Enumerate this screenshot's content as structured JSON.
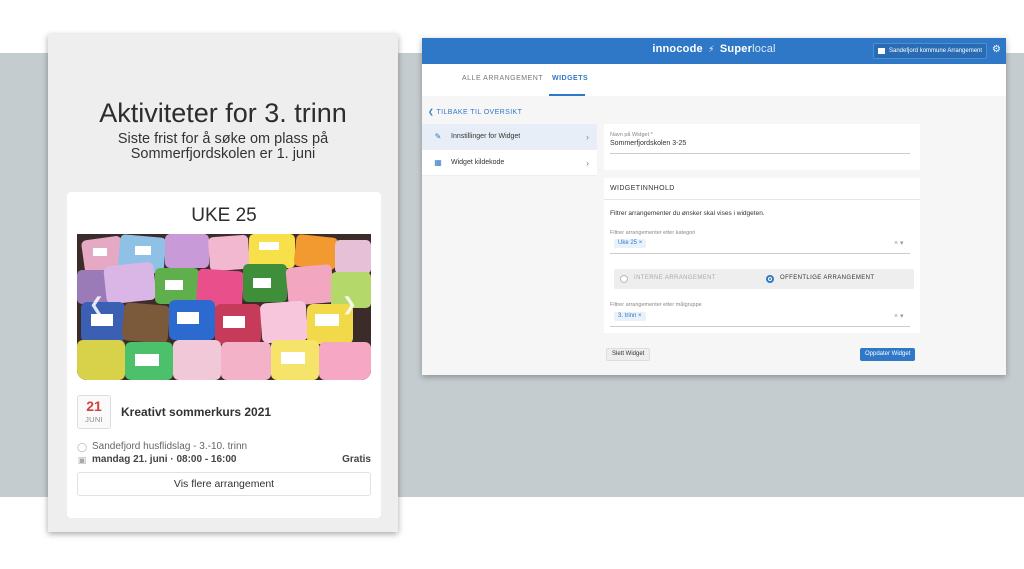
{
  "preview": {
    "title": "Aktiviteter for 3. trinn",
    "subtitle": "Siste frist for å søke om plass på Sommerfjordskolen er 1. juni",
    "week_title": "UKE 25",
    "event": {
      "day": "21",
      "month": "JUNI",
      "name": "Kreativt sommerkurs 2021",
      "location": "Sandefjord husflidslag - 3.-10. trinn",
      "time": "mandag 21. juni · 08:00 - 16:00",
      "price": "Gratis"
    },
    "more_button": "Vis flere arrangement",
    "icons": {
      "location": "location-pin-icon",
      "calendar": "calendar-icon",
      "prev": "chevron-left-icon",
      "next": "chevron-right-icon"
    }
  },
  "app": {
    "brand_left": "innocode",
    "brand_mid": "Super",
    "brand_right": "local",
    "org_button": "Sandefjord kommune Arrangement",
    "tabs": [
      {
        "label": "ALLE ARRANGEMENT"
      },
      {
        "label": "WIDGETS"
      }
    ],
    "back_link": "TILBAKE TIL OVERSIKT",
    "side_nav": [
      {
        "label": "Innstillinger for Widget",
        "icon": "pencil-icon"
      },
      {
        "label": "Widget kildekode",
        "icon": "code-table-icon"
      }
    ],
    "widget_name": {
      "label": "Navn på Widget *",
      "value": "Sommerfjordskolen 3-25"
    },
    "content": {
      "section_title": "WIDGETINNHOLD",
      "description": "Filtrer arrangementer du ønsker skal vises i widgeten.",
      "category_filter": {
        "label": "Filtrer arrangementer etter kategori",
        "chip": "Uke 25"
      },
      "radio_internal": "INTERNE ARRANGEMENT",
      "radio_public": "OFFENTLIGE ARRANGEMENT",
      "target_filter": {
        "label": "Filtrer arrangementer etter målgruppe",
        "chip": "3. trinn"
      },
      "chip_remove": "×",
      "clear": "×",
      "dropdown": "▾"
    },
    "delete_button": "Slett Widget",
    "update_button": "Oppdater Widget",
    "colors": {
      "header": "#2f78c7",
      "accent": "#2f78c7",
      "date": "#d04040"
    }
  }
}
